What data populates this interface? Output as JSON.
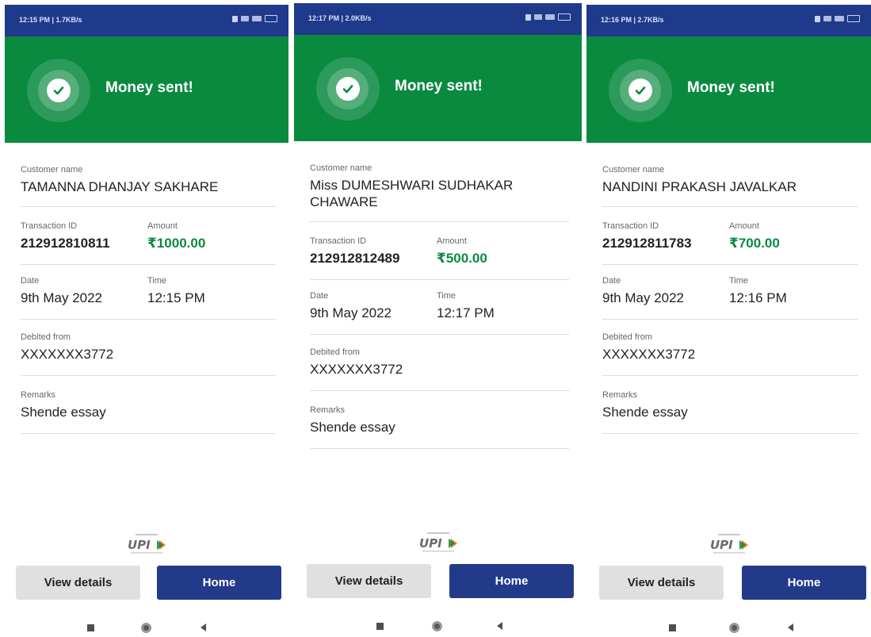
{
  "colors": {
    "status_bar": "#1f3a8a",
    "success_green": "#0a8a3f",
    "home_button": "#233a8b",
    "view_button": "#e0e0e0"
  },
  "common": {
    "banner_title": "Money sent!",
    "icon": "check-circle-icon",
    "labels": {
      "customer_name": "Customer name",
      "transaction_id": "Transaction ID",
      "amount": "Amount",
      "date": "Date",
      "time": "Time",
      "debited_from": "Debited from",
      "remarks": "Remarks"
    },
    "view_details_label": "View details",
    "home_label": "Home",
    "upi_logo": "UPI"
  },
  "screens": [
    {
      "status_text": "12:15 PM | 1.7KB/s",
      "customer_name": "TAMANNA DHANJAY SAKHARE",
      "transaction_id": "212912810811",
      "amount": "₹1000.00",
      "date": "9th May 2022",
      "time": "12:15 PM",
      "debited_from": "XXXXXXX3772",
      "remarks": "Shende essay"
    },
    {
      "status_text": "12:17 PM | 2.0KB/s",
      "customer_name": "Miss DUMESHWARI SUDHAKAR CHAWARE",
      "transaction_id": "212912812489",
      "amount": "₹500.00",
      "date": "9th May 2022",
      "time": "12:17 PM",
      "debited_from": "XXXXXXX3772",
      "remarks": "Shende essay"
    },
    {
      "status_text": "12:16 PM | 2.7KB/s",
      "customer_name": "NANDINI PRAKASH JAVALKAR",
      "transaction_id": "212912811783",
      "amount": "₹700.00",
      "date": "9th May 2022",
      "time": "12:16 PM",
      "debited_from": "XXXXXXX3772",
      "remarks": "Shende essay"
    }
  ]
}
